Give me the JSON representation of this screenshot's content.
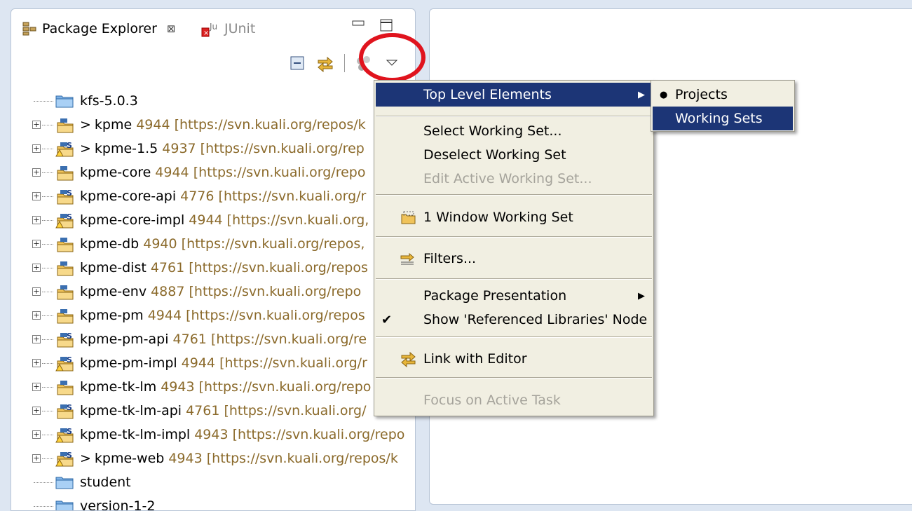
{
  "panel": {
    "tabs": [
      {
        "label": "Package Explorer",
        "icon": "package-explorer-icon",
        "active": true
      },
      {
        "label": "JUnit",
        "icon": "junit-icon",
        "active": false
      }
    ],
    "close_glyph": "⊠"
  },
  "toolbar": {
    "buttons": [
      {
        "name": "collapse-all-icon"
      },
      {
        "name": "link-with-editor-icon"
      },
      {
        "name": "focus-task-icon"
      },
      {
        "name": "view-menu-icon"
      }
    ]
  },
  "tree": {
    "items": [
      {
        "name": "kfs-5.0.3",
        "type": "folder",
        "prefix": "",
        "rev": "",
        "url": ""
      },
      {
        "name": "kpme",
        "type": "project",
        "prefix": ">",
        "rev": "4944",
        "url": "[https://svn.kuali.org/repos/k"
      },
      {
        "name": "kpme-1.5",
        "type": "project-warn",
        "prefix": ">",
        "rev": "4937",
        "url": "[https://svn.kuali.org/rep"
      },
      {
        "name": "kpme-core",
        "type": "project",
        "prefix": "",
        "rev": "4944",
        "url": "[https://svn.kuali.org/repo"
      },
      {
        "name": "kpme-core-api",
        "type": "project-s",
        "prefix": "",
        "rev": "4776",
        "url": "[https://svn.kuali.org/r"
      },
      {
        "name": "kpme-core-impl",
        "type": "project-warn",
        "prefix": "",
        "rev": "4944",
        "url": "[https://svn.kuali.org,"
      },
      {
        "name": "kpme-db",
        "type": "project",
        "prefix": "",
        "rev": "4940",
        "url": "[https://svn.kuali.org/repos,"
      },
      {
        "name": "kpme-dist",
        "type": "project",
        "prefix": "",
        "rev": "4761",
        "url": "[https://svn.kuali.org/repos"
      },
      {
        "name": "kpme-env",
        "type": "project",
        "prefix": "",
        "rev": "4887",
        "url": "[https://svn.kuali.org/repo"
      },
      {
        "name": "kpme-pm",
        "type": "project",
        "prefix": "",
        "rev": "4944",
        "url": "[https://svn.kuali.org/repos"
      },
      {
        "name": "kpme-pm-api",
        "type": "project-s",
        "prefix": "",
        "rev": "4761",
        "url": "[https://svn.kuali.org/re"
      },
      {
        "name": "kpme-pm-impl",
        "type": "project-warn",
        "prefix": "",
        "rev": "4944",
        "url": "[https://svn.kuali.org/r"
      },
      {
        "name": "kpme-tk-lm",
        "type": "project",
        "prefix": "",
        "rev": "4943",
        "url": "[https://svn.kuali.org/repo"
      },
      {
        "name": "kpme-tk-lm-api",
        "type": "project-s",
        "prefix": "",
        "rev": "4761",
        "url": "[https://svn.kuali.org/"
      },
      {
        "name": "kpme-tk-lm-impl",
        "type": "project-warn",
        "prefix": "",
        "rev": "4943",
        "url": "[https://svn.kuali.org/repo"
      },
      {
        "name": "kpme-web",
        "type": "project-warn",
        "prefix": ">",
        "rev": "4943",
        "url": "[https://svn.kuali.org/repos/k"
      },
      {
        "name": "student",
        "type": "folder",
        "prefix": "",
        "rev": "",
        "url": ""
      },
      {
        "name": "version-1-2",
        "type": "folder",
        "prefix": "",
        "rev": "",
        "url": ""
      }
    ]
  },
  "menu": {
    "items": [
      {
        "label": "Top Level Elements",
        "submenu": true,
        "selected": true,
        "disabled": false
      },
      {
        "label": "Select Working Set...",
        "submenu": false,
        "selected": false,
        "disabled": false
      },
      {
        "label": "Deselect Working Set",
        "submenu": false,
        "selected": false,
        "disabled": false
      },
      {
        "label": "Edit Active Working Set...",
        "submenu": false,
        "selected": false,
        "disabled": true
      },
      {
        "label": "1 Window Working Set",
        "submenu": false,
        "selected": false,
        "disabled": false,
        "icon": "working-set-icon"
      },
      {
        "label": "Filters...",
        "submenu": false,
        "selected": false,
        "disabled": false,
        "icon": "filter-icon"
      },
      {
        "label": "Package Presentation",
        "submenu": true,
        "selected": false,
        "disabled": false
      },
      {
        "label": "Show 'Referenced Libraries' Node",
        "submenu": false,
        "selected": false,
        "disabled": false,
        "checked": true
      },
      {
        "label": "Link with Editor",
        "submenu": false,
        "selected": false,
        "disabled": false,
        "icon": "link-icon"
      },
      {
        "label": "Focus on Active Task",
        "submenu": false,
        "selected": false,
        "disabled": true
      }
    ]
  },
  "submenu": {
    "items": [
      {
        "label": "Projects",
        "checked": true,
        "selected": false
      },
      {
        "label": "Working Sets",
        "checked": false,
        "selected": true
      }
    ]
  },
  "colors": {
    "menu_selected": "#1c3576",
    "revision_text": "#8b6a2b",
    "highlight_ring": "#e0141e"
  }
}
